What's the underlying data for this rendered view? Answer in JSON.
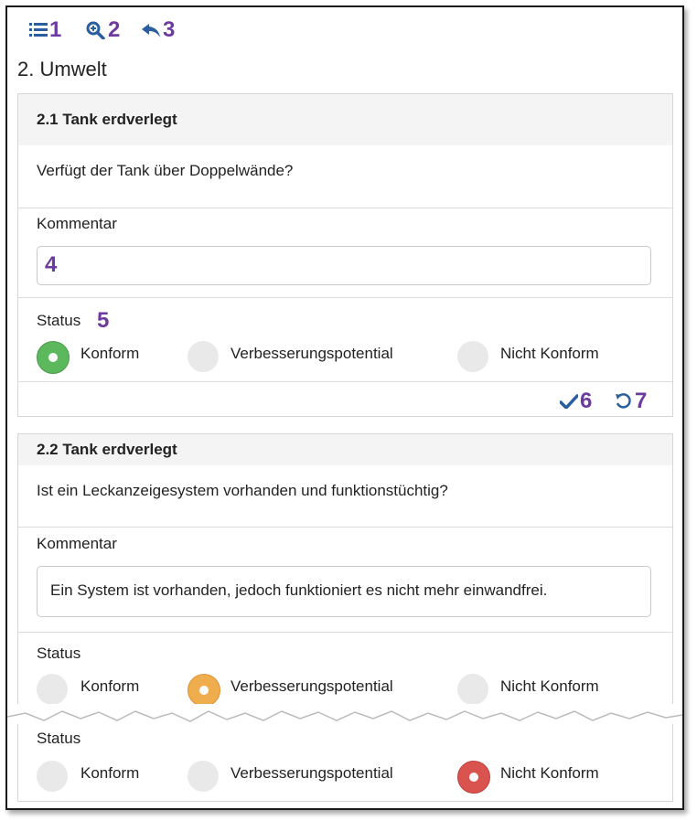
{
  "toolbar": {
    "items": [
      {
        "icon": "list-icon",
        "callout": "1"
      },
      {
        "icon": "zoom-in-icon",
        "callout": "2"
      },
      {
        "icon": "reply-icon",
        "callout": "3"
      }
    ],
    "accent": "#2a5e9e",
    "callout_color": "#6d3aa0"
  },
  "page_title": "2. Umwelt",
  "section1": {
    "heading": "2.1 Tank erdverlegt",
    "question": "Verfügt der Tank über Doppelwände?",
    "comment_label": "Kommentar",
    "comment_value": "",
    "comment_callout": "4",
    "status_label": "Status",
    "status_callout": "5",
    "options": [
      "Konform",
      "Verbesserungspotential",
      "Nicht Konform"
    ],
    "selected": "Konform",
    "save_callout": "6",
    "reset_callout": "7"
  },
  "section2": {
    "heading": "2.2 Tank erdverlegt",
    "question": "Ist ein Leckanzeigesystem vorhanden und funktionstüchtig?",
    "comment_label": "Kommentar",
    "comment_value": "Ein System ist vorhanden, jedoch funktioniert es nicht mehr einwandfrei.",
    "status_label": "Status",
    "options": [
      "Konform",
      "Verbesserungspotential",
      "Nicht Konform"
    ],
    "selected": "Verbesserungspotential"
  },
  "section3": {
    "status_label": "Status",
    "options": [
      "Konform",
      "Verbesserungspotential",
      "Nicht Konform"
    ],
    "selected": "Nicht Konform"
  },
  "status_colors": {
    "konform": "#5cb85c",
    "verbesserung": "#f0ad4e",
    "nicht_konform": "#d9534f"
  }
}
